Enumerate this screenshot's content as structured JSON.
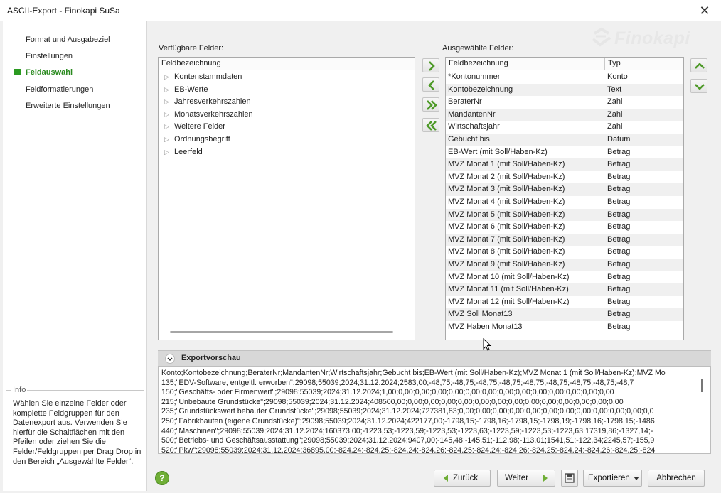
{
  "window": {
    "title": "ASCII-Export - Finokapi SuSa",
    "close_glyph": "✕"
  },
  "sidebar": {
    "items": [
      {
        "label": "Format und Ausgabeziel",
        "active": false
      },
      {
        "label": "Einstellungen",
        "active": false
      },
      {
        "label": "Feldauswahl",
        "active": true
      },
      {
        "label": "Feldformatierungen",
        "active": false
      },
      {
        "label": "Erweiterte Einstellungen",
        "active": false
      }
    ],
    "info": {
      "legend": "Info",
      "text": "Wählen Sie einzelne Felder oder komplette Feldgruppen für den Datenexport aus. Verwenden Sie hierfür die Schaltflächen mit den Pfeilen oder ziehen Sie die Felder/Feldgruppen per Drag Drop in den Bereich „Ausgewählte Felder“."
    }
  },
  "logo": {
    "text": "Finokapi"
  },
  "available": {
    "label": "Verfügbare Felder:",
    "column": "Feldbezeichnung",
    "items": [
      "Kontenstammdaten",
      "EB-Werte",
      "Jahresverkehrszahlen",
      "Monatsverkehrszahlen",
      "Weitere Felder",
      "Ordnungsbegriff",
      "Leerfeld"
    ]
  },
  "selected": {
    "label": "Ausgewählte Felder:",
    "columns": [
      "Feldbezeichnung",
      "Typ"
    ],
    "rows": [
      [
        "*Kontonummer",
        "Konto"
      ],
      [
        "Kontobezeichnung",
        "Text"
      ],
      [
        "BeraterNr",
        "Zahl"
      ],
      [
        "MandantenNr",
        "Zahl"
      ],
      [
        "Wirtschaftsjahr",
        "Zahl"
      ],
      [
        "Gebucht bis",
        "Datum"
      ],
      [
        "EB-Wert (mit Soll/Haben-Kz)",
        "Betrag"
      ],
      [
        "MVZ Monat 1 (mit Soll/Haben-Kz)",
        "Betrag"
      ],
      [
        "MVZ Monat 2 (mit Soll/Haben-Kz)",
        "Betrag"
      ],
      [
        "MVZ Monat 3 (mit Soll/Haben-Kz)",
        "Betrag"
      ],
      [
        "MVZ Monat 4 (mit Soll/Haben-Kz)",
        "Betrag"
      ],
      [
        "MVZ Monat 5 (mit Soll/Haben-Kz)",
        "Betrag"
      ],
      [
        "MVZ Monat 6 (mit Soll/Haben-Kz)",
        "Betrag"
      ],
      [
        "MVZ Monat 7 (mit Soll/Haben-Kz)",
        "Betrag"
      ],
      [
        "MVZ Monat 8 (mit Soll/Haben-Kz)",
        "Betrag"
      ],
      [
        "MVZ Monat 9 (mit Soll/Haben-Kz)",
        "Betrag"
      ],
      [
        "MVZ Monat 10 (mit Soll/Haben-Kz)",
        "Betrag"
      ],
      [
        "MVZ Monat 11 (mit Soll/Haben-Kz)",
        "Betrag"
      ],
      [
        "MVZ Monat 12 (mit Soll/Haben-Kz)",
        "Betrag"
      ],
      [
        "MVZ Soll Monat13",
        "Betrag"
      ],
      [
        "MVZ Haben Monat13",
        "Betrag"
      ]
    ]
  },
  "preview": {
    "title": "Exportvorschau",
    "lines": [
      "Konto;Kontobezeichnung;BeraterNr;MandantenNr;Wirtschaftsjahr;Gebucht bis;EB-Wert (mit Soll/Haben-Kz);MVZ Monat 1 (mit Soll/Haben-Kz);MVZ Mo",
      "135;\"EDV-Software, entgeltl. erworben\";29098;55039;2024;31.12.2024;2583,00;-48,75;-48,75;-48,75;-48,75;-48,75;-48,75;-48,75;-48,75;-48,7",
      "150;\"Geschäfts- oder Firmenwert\";29098;55039;2024;31.12.2024;1,00;0,00;0,00;0,00;0,00;0,00;0,00;0,00;0,00;0,00;0,00;0,00;0,00;0,00",
      "215;\"Unbebaute Grundstücke\";29098;55039;2024;31.12.2024;408500,00;0,00;0,00;0,00;0,00;0,00;0,00;0,00;0,00;0,00;0,00;0,00;0,00;0,00",
      "235;\"Grundstückswert bebauter Grundstücke\";29098;55039;2024;31.12.2024;727381,83;0,00;0,00;0,00;0,00;0,00;0,00;0,00;0,00;0,00;0,00;0,00;0,0",
      "250;\"Fabrikbauten (eigene Grundstücke)\";29098;55039;2024;31.12.2024;422177,00;-1798,15;-1798,16;-1798,15;-1798,19;-1798,16;-1798,15;-1486",
      "440;\"Maschinen\";29098;55039;2024;31.12.2024;160373,00;-1223,53;-1223,59;-1223,53;-1223,63;-1223,59;-1223,53;-1223,63;17319,86;-1327,14;-",
      "500;\"Betriebs- und Geschäftsausstattung\";29098;55039;2024;31.12.2024;9407,00;-145,48;-145,51;-112,98;-113,01;1541,51;-122,34;2245,57;-155,9",
      "520;\"Pkw\";29098;55039;2024;31.12.2024;36895,00;-824,24;-824,25;-824,24;-824,26;-824,25;-824,24;-824,26;-824,25;-824,24;-824,26;-824,25;-824"
    ]
  },
  "buttons": {
    "help": "?",
    "back": "Zurück",
    "next": "Weiter",
    "export": "Exportieren",
    "cancel": "Abbrechen"
  },
  "colors": {
    "accent_green": "#2a8a1f",
    "button_green": "#6fae36"
  }
}
